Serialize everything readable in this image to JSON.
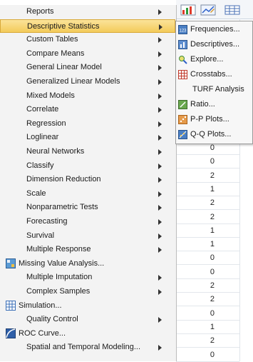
{
  "menu": {
    "items": [
      {
        "label": "Reports",
        "has_submenu": true
      },
      {
        "label": "Descriptive Statistics",
        "has_submenu": true,
        "active": true
      },
      {
        "label": "Custom Tables",
        "has_submenu": true
      },
      {
        "label": "Compare Means",
        "has_submenu": true
      },
      {
        "label": "General Linear Model",
        "has_submenu": true
      },
      {
        "label": "Generalized Linear Models",
        "has_submenu": true
      },
      {
        "label": "Mixed Models",
        "has_submenu": true
      },
      {
        "label": "Correlate",
        "has_submenu": true
      },
      {
        "label": "Regression",
        "has_submenu": true
      },
      {
        "label": "Loglinear",
        "has_submenu": true
      },
      {
        "label": "Neural Networks",
        "has_submenu": true
      },
      {
        "label": "Classify",
        "has_submenu": true
      },
      {
        "label": "Dimension Reduction",
        "has_submenu": true
      },
      {
        "label": "Scale",
        "has_submenu": true
      },
      {
        "label": "Nonparametric Tests",
        "has_submenu": true
      },
      {
        "label": "Forecasting",
        "has_submenu": true
      },
      {
        "label": "Survival",
        "has_submenu": true
      },
      {
        "label": "Multiple Response",
        "has_submenu": true
      },
      {
        "label": "Missing Value Analysis...",
        "has_submenu": false,
        "icon": "missing-value-icon"
      },
      {
        "label": "Multiple Imputation",
        "has_submenu": true
      },
      {
        "label": "Complex Samples",
        "has_submenu": true
      },
      {
        "label": "Simulation...",
        "has_submenu": false,
        "icon": "simulation-icon"
      },
      {
        "label": "Quality Control",
        "has_submenu": true
      },
      {
        "label": "ROC Curve...",
        "has_submenu": false,
        "icon": "roc-curve-icon"
      },
      {
        "label": "Spatial and Temporal Modeling...",
        "has_submenu": true
      }
    ]
  },
  "submenu": {
    "items": [
      {
        "label": "Frequencies...",
        "icon": "frequencies-icon"
      },
      {
        "label": "Descriptives...",
        "icon": "descriptives-icon"
      },
      {
        "label": "Explore...",
        "icon": "explore-icon"
      },
      {
        "label": "Crosstabs...",
        "icon": "crosstabs-icon"
      },
      {
        "label": "TURF Analysis",
        "icon": ""
      },
      {
        "label": "Ratio...",
        "icon": "ratio-icon"
      },
      {
        "label": "P-P Plots...",
        "icon": "pp-plots-icon"
      },
      {
        "label": "Q-Q Plots...",
        "icon": "qq-plots-icon"
      }
    ]
  },
  "grid": {
    "values": [
      "0",
      "0",
      "2",
      "1",
      "2",
      "2",
      "1",
      "1",
      "0",
      "0",
      "2",
      "2",
      "0",
      "1",
      "2",
      "0"
    ]
  },
  "colors": {
    "menu_bg": "#f3f3f3",
    "highlight": "#f3cb5a",
    "submenu_bg": "#f7f7f7"
  }
}
